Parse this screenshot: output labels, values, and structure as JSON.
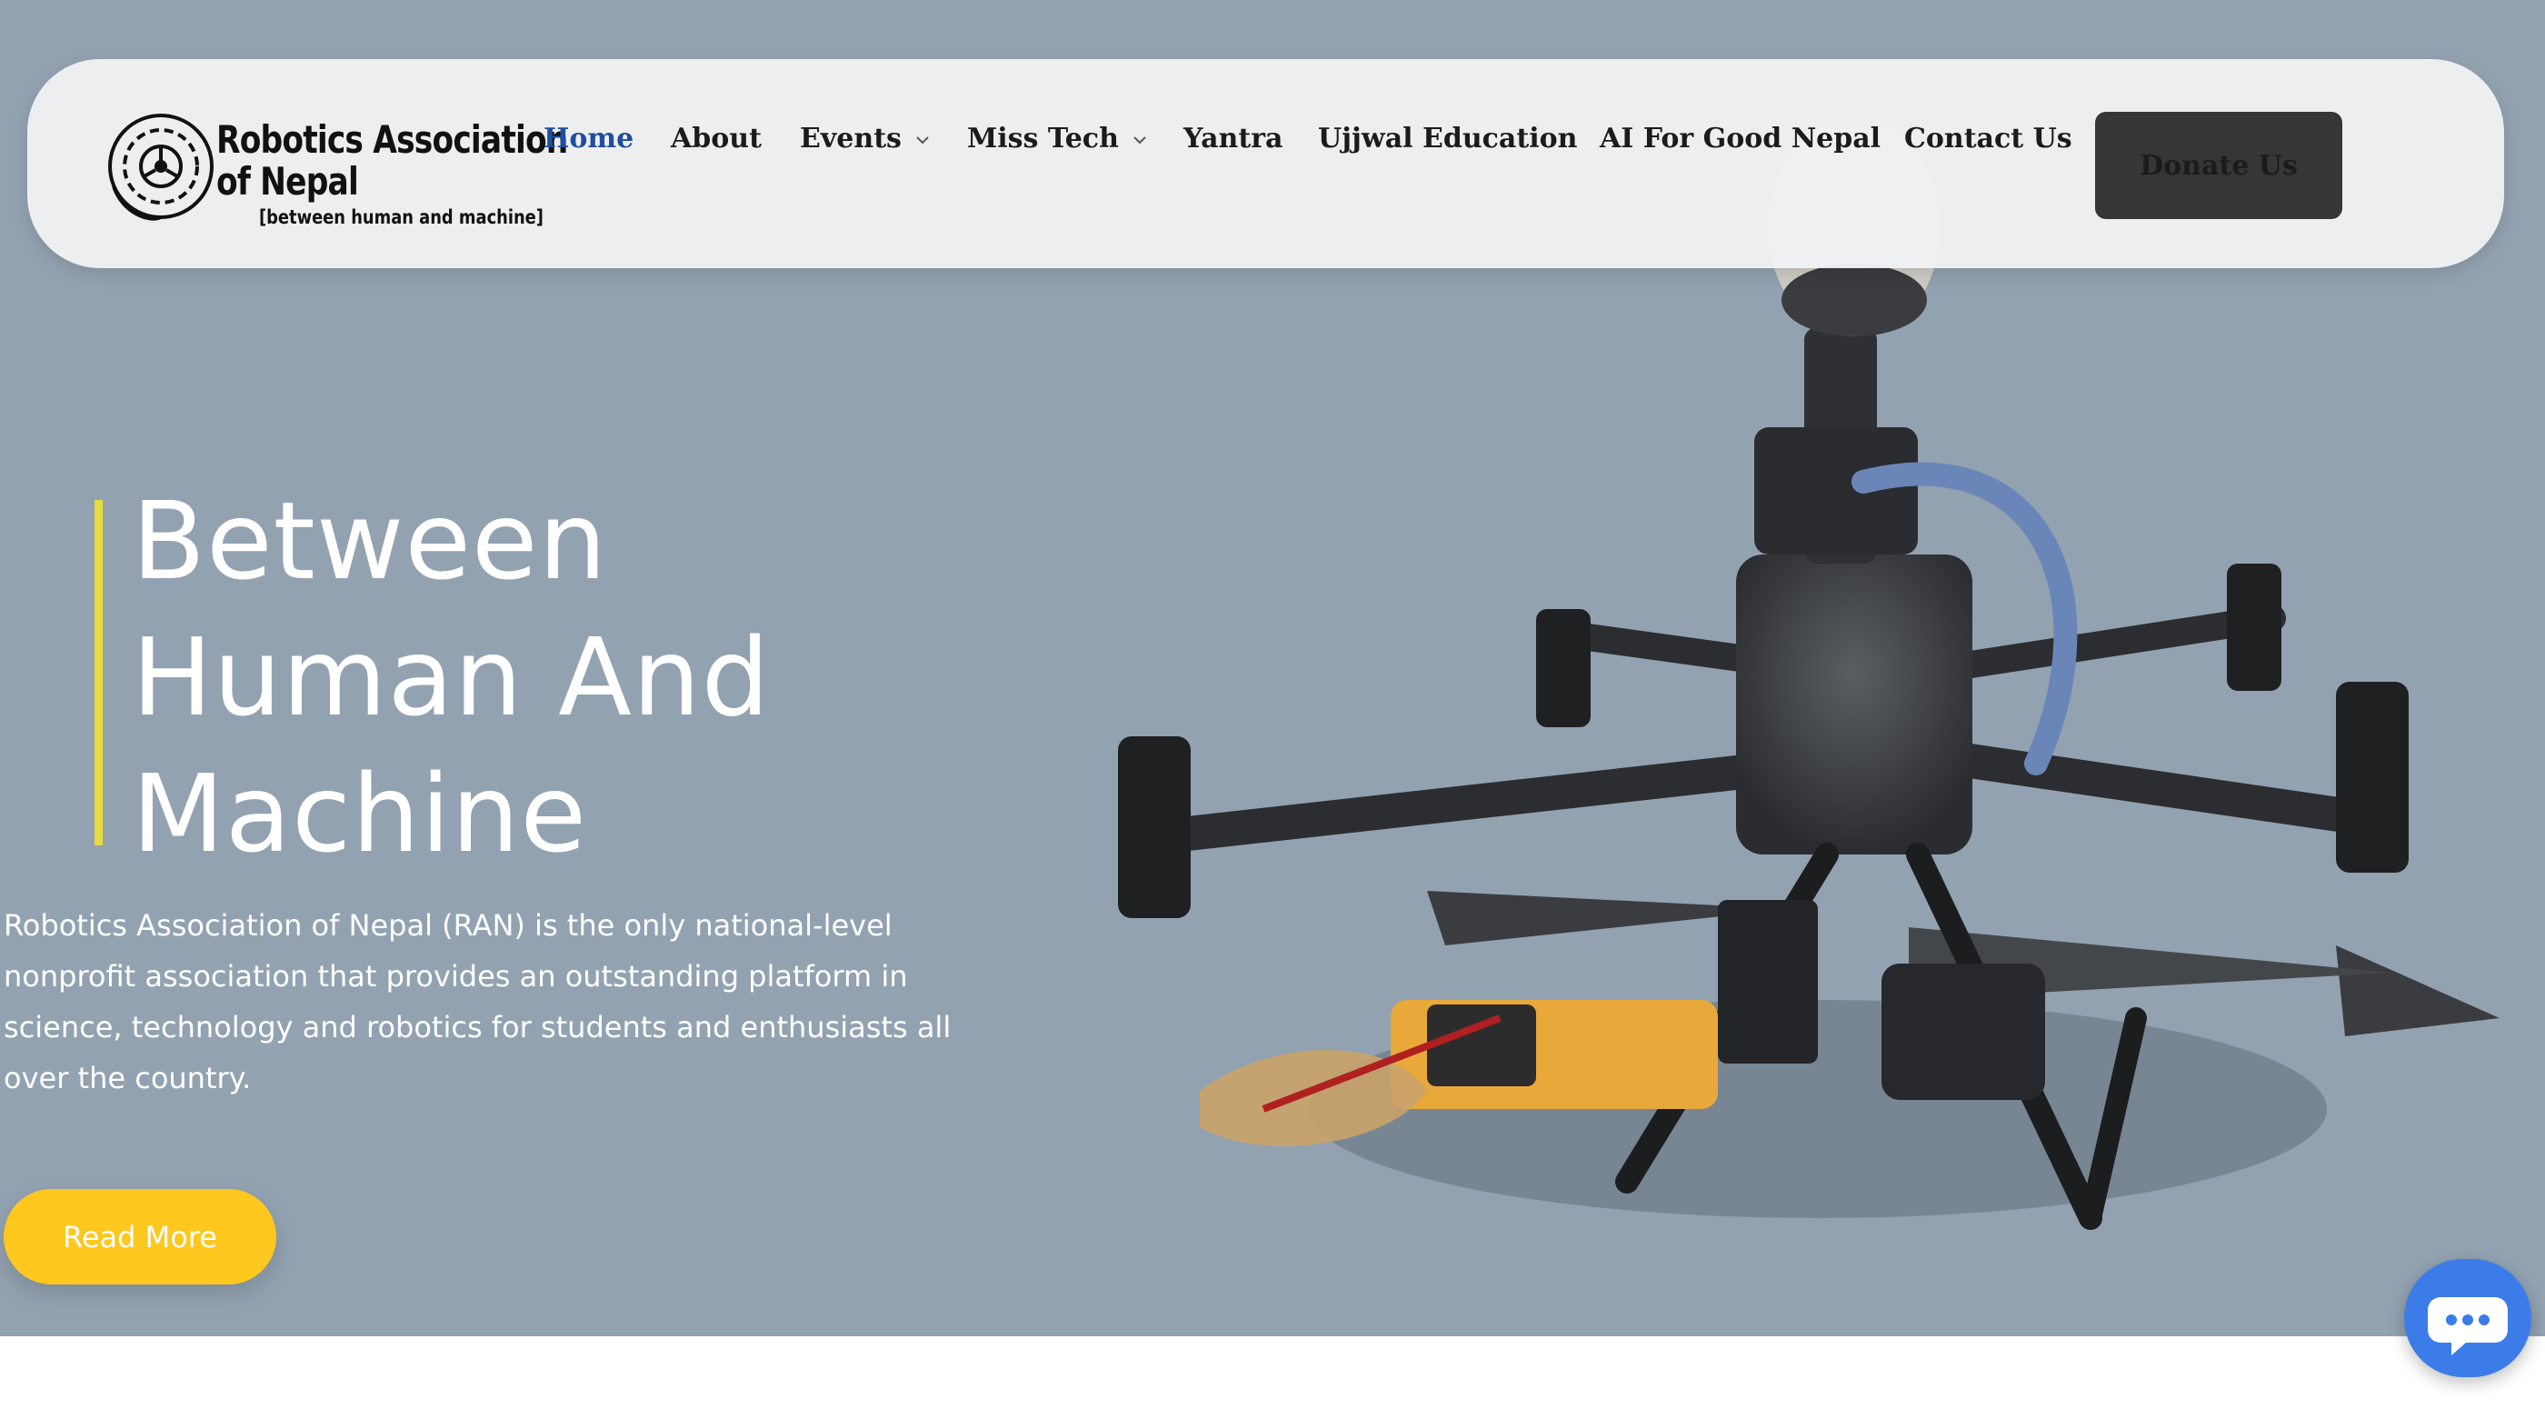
{
  "logo": {
    "line1": "Robotics Association",
    "line2": "of Nepal",
    "tagline": "[between human and machine]"
  },
  "nav": {
    "items": [
      {
        "label": "Home",
        "active": true
      },
      {
        "label": "About"
      },
      {
        "label": "Events",
        "has_dropdown": true
      },
      {
        "label": "Miss Tech",
        "has_dropdown": true
      },
      {
        "label": "Yantra"
      },
      {
        "label": "Ujjwal Education"
      },
      {
        "label": "AI For Good Nepal"
      },
      {
        "label": "Contact Us"
      }
    ],
    "donate_label": "Donate Us"
  },
  "hero": {
    "headline": [
      "Between",
      "Human And",
      "Machine"
    ],
    "description": "Robotics Association of Nepal (RAN) is the only national-level nonprofit association that provides an outstanding platform in science, technology and robotics for students and enthusiasts all over the country.",
    "cta_label": "Read More"
  },
  "colors": {
    "hero_bg": "#93a2b1",
    "accent_bar": "#e6dc3a",
    "nav_active": "#1f4e9c",
    "cta_bg": "#fec81e",
    "donate_bg": "#363636",
    "chat_bg": "#3b7ce8"
  },
  "icons": {
    "logo": "gear-emblem-icon",
    "dropdown": "chevron-down-icon",
    "chat": "chat-bubble-icon"
  }
}
